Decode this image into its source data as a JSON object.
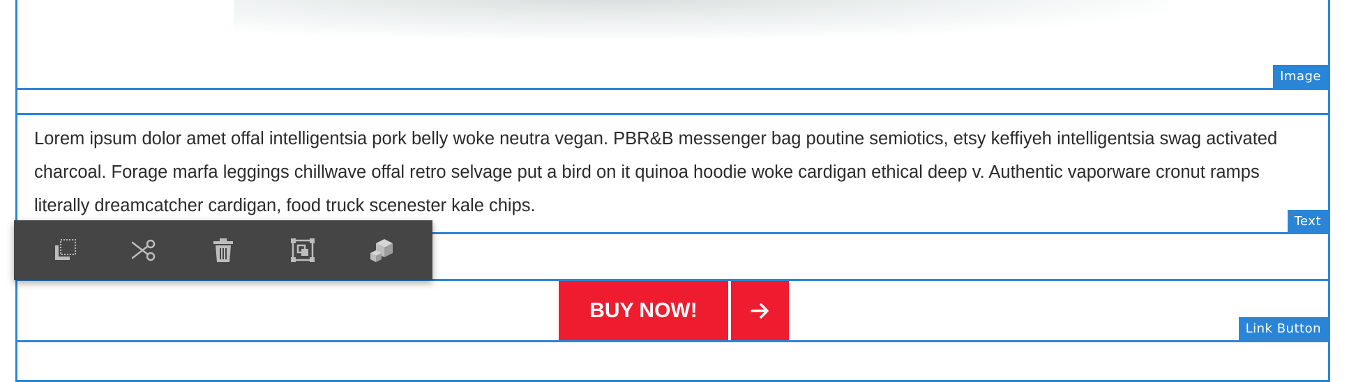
{
  "labels": {
    "image": "Image",
    "text": "Text",
    "link_button": "Link Button"
  },
  "text_component": {
    "body": "Lorem ipsum dolor amet offal intelligentsia pork belly woke neutra vegan. PBR&B messenger bag poutine semiotics, etsy keffiyeh intelligentsia swag activated charcoal. Forage marfa leggings chillwave offal retro selvage put a bird on it quinoa hoodie woke cardigan ethical deep v. Authentic vaporware cronut ramps literally dreamcatcher cardigan, food truck scenester kale chips."
  },
  "link_button": {
    "label": "BUY NOW!",
    "icon": "arrow-right-icon",
    "color": "#ee1c2e"
  },
  "toolbar": {
    "tools": [
      {
        "name": "copy",
        "icon": "copy-icon"
      },
      {
        "name": "cut",
        "icon": "scissors-icon"
      },
      {
        "name": "delete",
        "icon": "trash-icon"
      },
      {
        "name": "group",
        "icon": "group-icon"
      },
      {
        "name": "convert",
        "icon": "boxes-icon"
      }
    ]
  },
  "colors": {
    "outline": "#2a85d6",
    "toolbar_bg": "#454545",
    "accent": "#ee1c2e"
  }
}
